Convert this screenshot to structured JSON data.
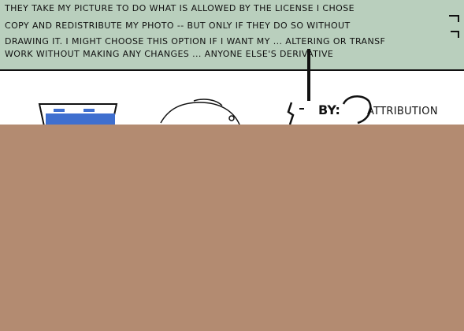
{
  "banner": {
    "lines": [
      "THEY TAKE MY PICTURE TO DO WHAT IS ALLOWED BY THE LICENSE I CHOSE",
      "COPY AND REDISTRIBUTE MY PHOTO -- BUT ONLY IF THEY DO SO WITHOUT",
      "DRAWING IT. I MIGHT CHOOSE THIS OPTION IF I WANT MY ... ALTERING OR TRANSF",
      "WORK WITHOUT MAKING ANY CHANGES ... ANYONE ELSE'S DERIVATIVE"
    ],
    "readable_line_index": 1,
    "background_color": "#b9cfbd"
  },
  "license": {
    "badge_text": "BY:",
    "attribution_label": "ATTRIBUTION"
  },
  "colors": {
    "bottom_fill": "#b38b71",
    "cup_blue": "#3f6fcf",
    "ink": "#111111"
  },
  "icons": {
    "badge": "cc-by-icon",
    "cup": "blue-cup-icon",
    "head": "sketch-head-icon"
  }
}
